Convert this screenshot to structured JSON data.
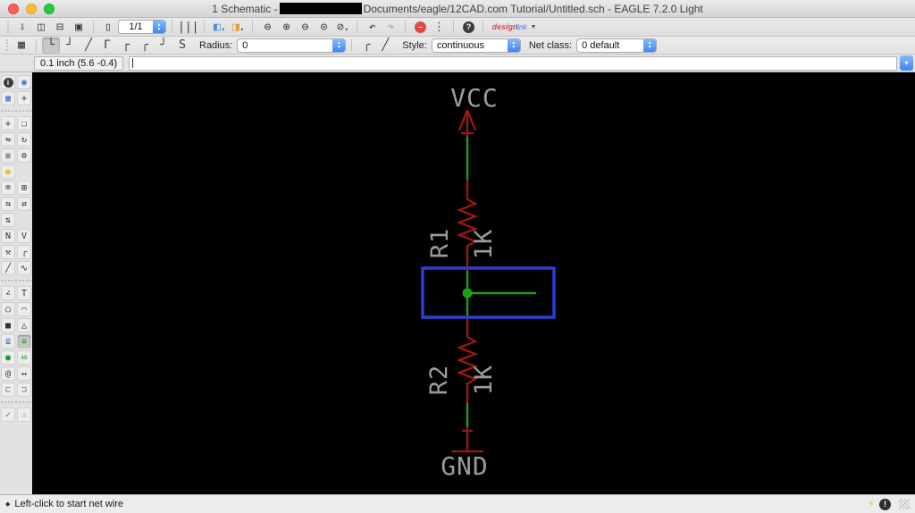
{
  "window": {
    "title_prefix": "1 Schematic - ",
    "title_suffix": "Documents/eagle/12CAD.com Tutorial/Untitled.sch - EAGLE 7.2.0 Light"
  },
  "icons": {
    "stepper_up": "▲",
    "stepper_down": "▼",
    "dropdown": "▾",
    "brand_arrow": "▼",
    "bolt": "⚡",
    "alert": "!"
  },
  "toolbar_main": {
    "file_buttons": [
      {
        "name": "open",
        "glyph": "⇩"
      },
      {
        "name": "save",
        "glyph": "◫"
      },
      {
        "name": "print",
        "glyph": "⊟"
      },
      {
        "name": "export-image",
        "glyph": "▣"
      }
    ],
    "sheet_button": [
      {
        "name": "sheet-thumbnail",
        "glyph": "▯",
        "color": "#444444"
      }
    ],
    "sheet_value": "1/1",
    "layer_button": [
      {
        "name": "layer-settings",
        "glyph": "|||"
      }
    ],
    "switch_buttons": [
      {
        "name": "switch-to-board",
        "glyph": "◧",
        "color": "#4a8fd4",
        "dropdown": true
      },
      {
        "name": "run-ulp",
        "glyph": "◨",
        "color": "#e0a030",
        "dropdown": true
      }
    ],
    "zoom_buttons": [
      {
        "name": "zoom-fit",
        "glyph": "⊜"
      },
      {
        "name": "zoom-in",
        "glyph": "⊕"
      },
      {
        "name": "zoom-out",
        "glyph": "⊖"
      },
      {
        "name": "zoom-select",
        "glyph": "⊙"
      },
      {
        "name": "zoom-redraw",
        "glyph": "⊘",
        "dropdown": true
      }
    ],
    "history_buttons": [
      {
        "name": "undo",
        "glyph": "↶"
      },
      {
        "name": "redo",
        "glyph": "↷",
        "disabled": true
      }
    ],
    "stop_buttons": [
      {
        "name": "stop",
        "glyph": "–",
        "circle": "cred"
      },
      {
        "name": "script-dots",
        "glyph": "⋮"
      }
    ],
    "help_button": [
      {
        "name": "help",
        "glyph": "?",
        "circle": "cdark"
      }
    ],
    "brand": {
      "word1": "design",
      "word2": "link"
    }
  },
  "toolbar_params": {
    "grid_button": [
      {
        "name": "grid-settings",
        "glyph": "▦"
      }
    ],
    "bend_buttons": [
      {
        "name": "bend-90-vertical-horizontal",
        "glyph": "└",
        "active": true
      },
      {
        "name": "bend-90-horizontal-vertical",
        "glyph": "┘"
      },
      {
        "name": "bend-45-diagonal",
        "glyph": "╱"
      },
      {
        "name": "bend-45-then-straight",
        "glyph": "Γ"
      },
      {
        "name": "bend-straight-then-45",
        "glyph": "┌"
      },
      {
        "name": "bend-arc-90",
        "glyph": "╭"
      },
      {
        "name": "bend-arc-alt",
        "glyph": "╯"
      },
      {
        "name": "bend-freehand",
        "glyph": "S"
      }
    ],
    "radius_label": "Radius:",
    "radius_value": "0",
    "miter_buttons": [
      {
        "name": "miter-arc",
        "glyph": "╭"
      },
      {
        "name": "miter-line",
        "glyph": "╱"
      }
    ],
    "style_label": "Style:",
    "style_value": "continuous",
    "netclass_label": "Net class:",
    "netclass_value": "0 default"
  },
  "command_bar": {
    "coordinates": "0.1 inch (5.6 -0.4)",
    "input_value": ""
  },
  "sidebar": {
    "tools": [
      {
        "name": "info",
        "glyph": "i",
        "circle": "cdark"
      },
      {
        "name": "show",
        "glyph": "◉",
        "color": "#2b7bd3"
      },
      {
        "name": "display-layers",
        "glyph": "▦",
        "color": "#4a6fd4"
      },
      {
        "name": "mark",
        "glyph": "+"
      },
      {
        "divider": true
      },
      {
        "name": "move",
        "glyph": "✛"
      },
      {
        "name": "copy",
        "glyph": "❏"
      },
      {
        "name": "mirror",
        "glyph": "⇋"
      },
      {
        "name": "rotate",
        "glyph": "↻"
      },
      {
        "name": "group",
        "glyph": "▣",
        "color": "#8a8a8a"
      },
      {
        "name": "change",
        "glyph": "⚙"
      },
      {
        "name": "paste",
        "glyph": "●",
        "color": "#eec425"
      },
      {
        "spacer": true
      },
      {
        "name": "delete",
        "glyph": "⌧"
      },
      {
        "name": "add-part",
        "glyph": "⊞"
      },
      {
        "name": "pinswap",
        "glyph": "⇆"
      },
      {
        "name": "replace",
        "glyph": "⇄"
      },
      {
        "name": "gateswap",
        "glyph": "⇅"
      },
      {
        "spacer": true
      },
      {
        "name": "name",
        "glyph": "N"
      },
      {
        "name": "value",
        "glyph": "V"
      },
      {
        "name": "smash",
        "glyph": "⚒"
      },
      {
        "name": "miter",
        "glyph": "╭"
      },
      {
        "name": "split",
        "glyph": "╱"
      },
      {
        "name": "optimize",
        "glyph": "∿"
      },
      {
        "divider": true
      },
      {
        "name": "wire",
        "glyph": "∠"
      },
      {
        "name": "text",
        "glyph": "T"
      },
      {
        "name": "circle",
        "glyph": "○"
      },
      {
        "name": "arc",
        "glyph": "⌒"
      },
      {
        "name": "rect",
        "glyph": "■"
      },
      {
        "name": "polygon",
        "glyph": "△"
      },
      {
        "name": "bus",
        "glyph": "≣",
        "color": "#2c5fd8"
      },
      {
        "name": "net",
        "glyph": "≡",
        "color": "#1f9e1f",
        "active": true
      },
      {
        "name": "junction",
        "glyph": "●",
        "color": "#1f9e1f"
      },
      {
        "name": "label",
        "glyph": "AB",
        "color": "#1f9e1f",
        "small": true
      },
      {
        "name": "attribute",
        "glyph": "@"
      },
      {
        "name": "dimension",
        "glyph": "↔"
      },
      {
        "name": "pin",
        "glyph": "⊏",
        "color": "#a050c0"
      },
      {
        "name": "port",
        "glyph": "⊐",
        "color": "#a050c0"
      },
      {
        "divider": true
      },
      {
        "name": "erc",
        "glyph": "✓",
        "color": "#1f9e1f"
      },
      {
        "name": "errors",
        "glyph": "⚠",
        "color": "#d89020"
      }
    ]
  },
  "canvas": {
    "colors": {
      "background": "#000000",
      "wire_green": "#1aa21a",
      "part_red": "#9a1812",
      "label_gray": "#9c9c9c",
      "selection_blue": "#2a3fd4"
    }
  },
  "schematic": {
    "vcc": "VCC",
    "gnd": "GND",
    "r1_name": "R1",
    "r1_value": "1K",
    "r2_name": "R2",
    "r2_value": "1K"
  },
  "status_bar": {
    "bullet": "◆",
    "hint": "Left-click to start net wire"
  }
}
